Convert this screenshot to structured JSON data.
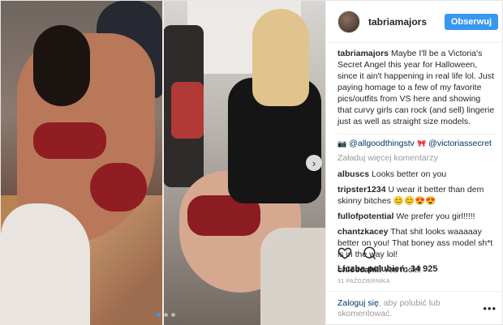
{
  "post": {
    "username": "tabriamajors",
    "follow_label": "Obserwuj",
    "caption_user": "tabriamajors",
    "caption_text": "Maybe I'll be a Victoria's Secret Angel this year for Halloween, since it ain't happening in real life lol. Just paying homage to a few of my favorite pics/outfits from VS here and showing that curvy girls can rock (and sell) lingerie just as well as straight size models.",
    "tags": {
      "mention_1": "@allgoodthingstv",
      "mention_2": "@victoriassecret"
    },
    "load_more_label": "Załaduj więcej komentarzy",
    "comments": [
      {
        "user": "albuscs",
        "text": "Looks better on you"
      },
      {
        "user": "tripster1234",
        "text": "U wear it better than dem skinny bitches 😊😊😍😍"
      },
      {
        "user": "fullofpotential",
        "text": "We prefer you girl!!!!!"
      },
      {
        "user": "chantzkacey",
        "text": "That shit looks waaaaay better on you! That boney ass model sh*t is in the way lol!"
      },
      {
        "user": "chloecahill",
        "text": "You rock!!"
      }
    ],
    "likes_label": "Liczba polubień: 34 925",
    "date_label": "31 PAŹDZIERNIKA",
    "footer": {
      "login_link": "Zaloguj się",
      "login_suffix": ", aby polubić lub skomentować.",
      "more_icon": "ellipsis-icon"
    },
    "icons": {
      "like": "heart-icon",
      "comment": "comment-icon",
      "next": "chevron-right-icon"
    },
    "colors": {
      "accent": "#3897f0",
      "link": "#003569",
      "muted": "#999999"
    },
    "carousel": {
      "slides": 3,
      "active_slide": 1
    }
  }
}
